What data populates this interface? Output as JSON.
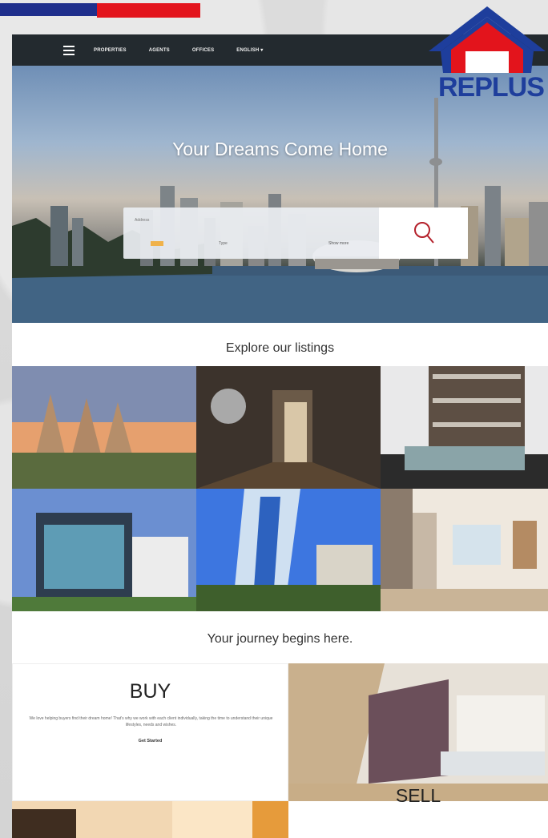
{
  "nav": {
    "items": [
      "PROPERTIES",
      "AGENTS",
      "OFFICES",
      "ENGLISH ▾"
    ]
  },
  "logo": {
    "text": "REPLUS"
  },
  "hero": {
    "title": "Your Dreams Come Home",
    "search_placeholder": "Address",
    "filter_label": "Type",
    "more_label": "Show more"
  },
  "listings_heading": "Explore our listings",
  "journey_heading": "Your journey begins here.",
  "buy": {
    "title": "BUY",
    "text": "We love helping buyers find their dream home! That's why we work with each client individually, taking the time to understand their unique lifestyles, needs and wishes.",
    "link": "Get Started"
  },
  "sell": {
    "title": "SELL"
  },
  "colors": {
    "brand_blue": "#1e3e9c",
    "brand_red": "#e3141c",
    "navbar": "#232a2f"
  }
}
